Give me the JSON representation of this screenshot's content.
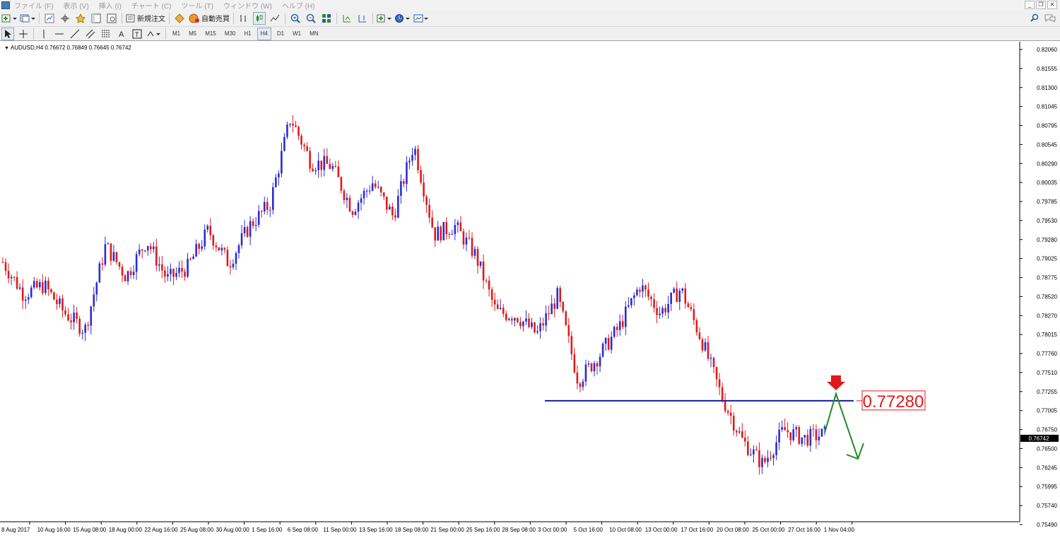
{
  "menu": {
    "items": [
      "ファイル (F)",
      "表示 (V)",
      "挿入 (I)",
      "チャート (C)",
      "ツール (T)",
      "ウィンドウ (W)",
      "ヘルプ (H)"
    ]
  },
  "toolbar": {
    "new_order_label": "新規注文",
    "auto_trade_label": "自動売買",
    "timeframes": [
      "M1",
      "M5",
      "M15",
      "M30",
      "H1",
      "H4",
      "D1",
      "W1",
      "MN"
    ],
    "active_timeframe": "H4"
  },
  "chart": {
    "symbol_info": "AUDUSD,H4  0.76672 0.76849 0.76645 0.76742",
    "price_levels": [
      "0.82060",
      "0.81555",
      "0.81300",
      "0.81045",
      "0.80795",
      "0.80545",
      "0.80290",
      "0.80035",
      "0.79785",
      "0.79530",
      "0.79280",
      "0.79025",
      "0.78775",
      "0.78520",
      "0.78270",
      "0.78015",
      "0.77760",
      "0.77510",
      "0.77255",
      "0.77005",
      "0.76750",
      "0.76500",
      "0.76245",
      "0.75995",
      "0.75740",
      "0.75490"
    ],
    "time_labels": [
      "8 Aug 2017",
      "10 Aug 16:00",
      "15 Aug 08:00",
      "18 Aug 00:00",
      "22 Aug 16:00",
      "25 Aug 08:00",
      "30 Aug 00:00",
      "1 Sep 16:00",
      "6 Sep 08:00",
      "11 Sep 00:00",
      "13 Sep 16:00",
      "18 Sep 08:00",
      "21 Sep 00:00",
      "25 Sep 16:00",
      "28 Sep 08:00",
      "3 Oct 00:00",
      "5 Oct 16:00",
      "10 Oct 08:00",
      "13 Oct 00:00",
      "17 Oct 16:00",
      "20 Oct 08:00",
      "25 Oct 00:00",
      "27 Oct 16:00",
      "1 Nov 04:00"
    ],
    "current_price": "0.76742",
    "annotation_price": "0.77280",
    "colors": {
      "bull": "#2b2bd6",
      "bear": "#e01a1a",
      "horizontal_line": "#1a1aa0",
      "annotation": "#e01a1a",
      "projection": "#1f8c1f"
    }
  },
  "chart_data": {
    "type": "candlestick",
    "symbol": "AUDUSD",
    "timeframe": "H4",
    "ohlc": {
      "open": 0.76672,
      "high": 0.76849,
      "low": 0.76645,
      "close": 0.76742
    },
    "ylim": [
      0.7549,
      0.8206
    ],
    "x": [
      "8 Aug 2017",
      "10 Aug 16:00",
      "15 Aug 08:00",
      "18 Aug 00:00",
      "22 Aug 16:00",
      "25 Aug 08:00",
      "30 Aug 00:00",
      "1 Sep 16:00",
      "6 Sep 08:00",
      "11 Sep 00:00",
      "13 Sep 16:00",
      "18 Sep 08:00",
      "21 Sep 00:00",
      "25 Sep 16:00",
      "28 Sep 08:00",
      "3 Oct 00:00",
      "5 Oct 16:00",
      "10 Oct 08:00",
      "13 Oct 00:00",
      "17 Oct 16:00",
      "20 Oct 08:00",
      "25 Oct 00:00",
      "27 Oct 16:00",
      "1 Nov 04:00"
    ],
    "close_path": [
      0.7912,
      0.7868,
      0.788,
      0.7842,
      0.7818,
      0.7935,
      0.7892,
      0.7942,
      0.7888,
      0.7905,
      0.7956,
      0.791,
      0.7962,
      0.7992,
      0.8112,
      0.805,
      0.8045,
      0.7985,
      0.8022,
      0.7975,
      0.8075,
      0.795,
      0.7962,
      0.7922,
      0.7843,
      0.7838,
      0.7812,
      0.7865,
      0.7748,
      0.7782,
      0.7822,
      0.788,
      0.7842,
      0.7875,
      0.7805,
      0.7725,
      0.7665,
      0.7632,
      0.768,
      0.7668,
      0.7674
    ],
    "horizontal_level": 0.7728
  }
}
